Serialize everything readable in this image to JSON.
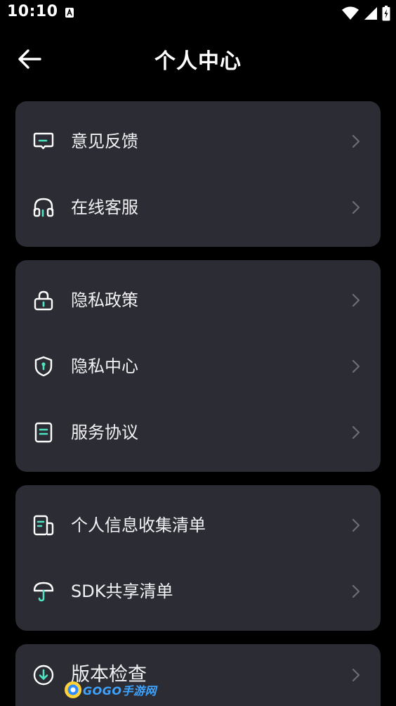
{
  "status_bar": {
    "time": "10:10"
  },
  "app_bar": {
    "title": "个人中心"
  },
  "cards": [
    {
      "items": [
        {
          "label": "意见反馈",
          "icon": "feedback-icon"
        },
        {
          "label": "在线客服",
          "icon": "headset-icon"
        }
      ]
    },
    {
      "items": [
        {
          "label": "隐私政策",
          "icon": "lock-icon"
        },
        {
          "label": "隐私中心",
          "icon": "shield-icon"
        },
        {
          "label": "服务协议",
          "icon": "document-icon"
        }
      ]
    },
    {
      "items": [
        {
          "label": "个人信息收集清单",
          "icon": "info-list-icon"
        },
        {
          "label": "SDK共享清单",
          "icon": "umbrella-icon"
        }
      ]
    },
    {
      "items": [
        {
          "label": "版本检查",
          "icon": "download-icon"
        }
      ]
    }
  ],
  "watermark": {
    "text": "GOGO手游网"
  },
  "colors": {
    "accent": "#4fe3c1",
    "card": "#2b2c34",
    "background": "#000000"
  }
}
